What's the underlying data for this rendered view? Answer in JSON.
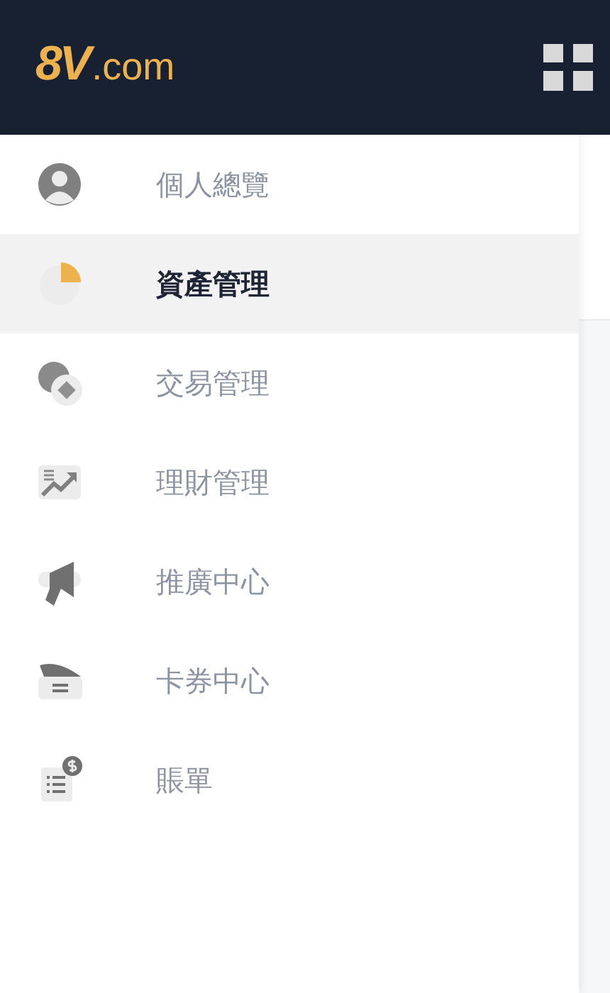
{
  "header": {
    "logo_mark": "8V",
    "logo_suffix": ".com"
  },
  "menu": [
    {
      "kind": "profile",
      "label": "個人總覽",
      "selected": false
    },
    {
      "kind": "assets",
      "label": "資產管理",
      "selected": true
    },
    {
      "kind": "trade",
      "label": "交易管理",
      "selected": false
    },
    {
      "kind": "finance",
      "label": "理財管理",
      "selected": false
    },
    {
      "kind": "promo",
      "label": "推廣中心",
      "selected": false
    },
    {
      "kind": "coupon",
      "label": "卡券中心",
      "selected": false
    },
    {
      "kind": "bill",
      "label": "賬單",
      "selected": false
    }
  ]
}
